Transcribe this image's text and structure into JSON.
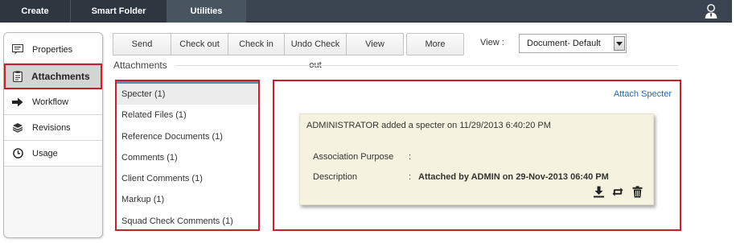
{
  "topmenu": {
    "items": [
      {
        "label": "Create"
      },
      {
        "label": "Smart Folder"
      },
      {
        "label": "Utilities"
      }
    ],
    "user_icon": "user-icon"
  },
  "sidebar": {
    "items": [
      {
        "label": "Properties",
        "icon": "properties-icon",
        "active": false
      },
      {
        "label": "Attachments",
        "icon": "clipboard-icon",
        "active": true
      },
      {
        "label": "Workflow",
        "icon": "arrow-right-icon",
        "active": false
      },
      {
        "label": "Revisions",
        "icon": "stack-icon",
        "active": false
      },
      {
        "label": "Usage",
        "icon": "clock-icon",
        "active": false
      }
    ]
  },
  "toolbar": {
    "send": "Send",
    "checkout": "Check out",
    "checkin": "Check in",
    "undo_checkout": "Undo Check out",
    "view": "View",
    "more": "More"
  },
  "view_selector": {
    "label": "View :",
    "selected": "Document- Default"
  },
  "section": {
    "title": "Attachments"
  },
  "attachment_types": [
    {
      "label": "Specter (1)",
      "active": true
    },
    {
      "label": "Related Files (1)",
      "active": false
    },
    {
      "label": "Reference Documents (1)",
      "active": false
    },
    {
      "label": "Comments (1)",
      "active": false
    },
    {
      "label": "Client Comments (1)",
      "active": false
    },
    {
      "label": "Markup (1)",
      "active": false
    },
    {
      "label": "Squad Check Comments (1)",
      "active": false
    }
  ],
  "details": {
    "attach_link": "Attach Specter",
    "card": {
      "header": "ADMINISTRATOR added a specter on 11/29/2013 6:40:20 PM",
      "purpose_label": "Association Purpose",
      "purpose_value": "",
      "description_label": "Description",
      "description_value": "Attached by ADMIN on 29-Nov-2013 06:40 PM",
      "colon": ":"
    }
  },
  "colors": {
    "topbar": "#3a4450",
    "highlight_border": "#cc1f2d",
    "link": "#1f6fb3",
    "card_bg": "#f5f3df",
    "list_accent": "#5f86c6"
  }
}
